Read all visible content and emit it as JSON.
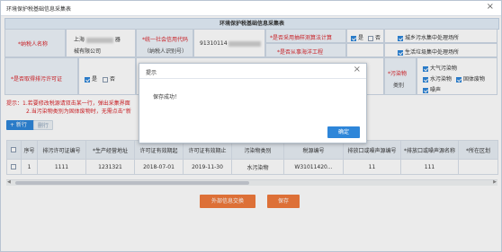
{
  "window": {
    "title": "环境保护税基础信息采集表",
    "close": "×"
  },
  "form": {
    "title": "环境保护税基础信息采集表",
    "taxpayer_name_label": "*纳税人名称",
    "taxpayer_name_value_1": "上海",
    "taxpayer_name_value_tail": "器",
    "taxpayer_name_value_2": "械有限公司",
    "credit_code_label_1": "*统一社会信用代码",
    "credit_code_label_2": "（纳税人识别号）",
    "credit_code_value": "91310114",
    "sampling_label": "*是否采用抽样测算法计算",
    "sampling_yes": "是",
    "sampling_no": "否",
    "marine_label": "*是否从事海洋工程",
    "urban_sewage": "城乡污水集中处理场所",
    "domestic_waste": "生活垃圾集中处理场所",
    "permit_label": "*是否取得排污许可证",
    "permit_yes": "是",
    "permit_no": "否",
    "pollutant_label_1": "*污染物",
    "pollutant_label_2": "类别",
    "pollutants": [
      "大气污染物",
      "水污染物",
      "固体废物",
      "噪声"
    ]
  },
  "hint": {
    "prefix": "提示：1.若要修改",
    "line1": "提示：1.若要修改税源请双击某一行，弹出采集界面",
    "line2": "2.当污染物类别为固体废物时，无需点击“新"
  },
  "toolbar": {
    "add": "+ 新行",
    "delete": "删行"
  },
  "table": {
    "headers": [
      "",
      "序号",
      "排污许可证编号",
      "*生产经营地址",
      "许可证有效期起",
      "许可证有效期止",
      "污染物类别",
      "税源编号",
      "排放口或噪声源编号",
      "*排放口或噪声源名称",
      "*所在区划"
    ],
    "rows": [
      [
        "",
        "1",
        "1111",
        "1231321",
        "2018-07-01",
        "2019-11-30",
        "水污染物",
        "W31011420...",
        "11",
        "111",
        ""
      ]
    ]
  },
  "buttons": {
    "external": "外部信息交换",
    "save": "保存"
  },
  "dialog": {
    "title": "提示",
    "close": "×",
    "message": "保存成功！",
    "ok": "确定"
  },
  "colors": {
    "accent": "#2e86d9",
    "action": "#f07a3c",
    "warning": "#d9242a"
  }
}
